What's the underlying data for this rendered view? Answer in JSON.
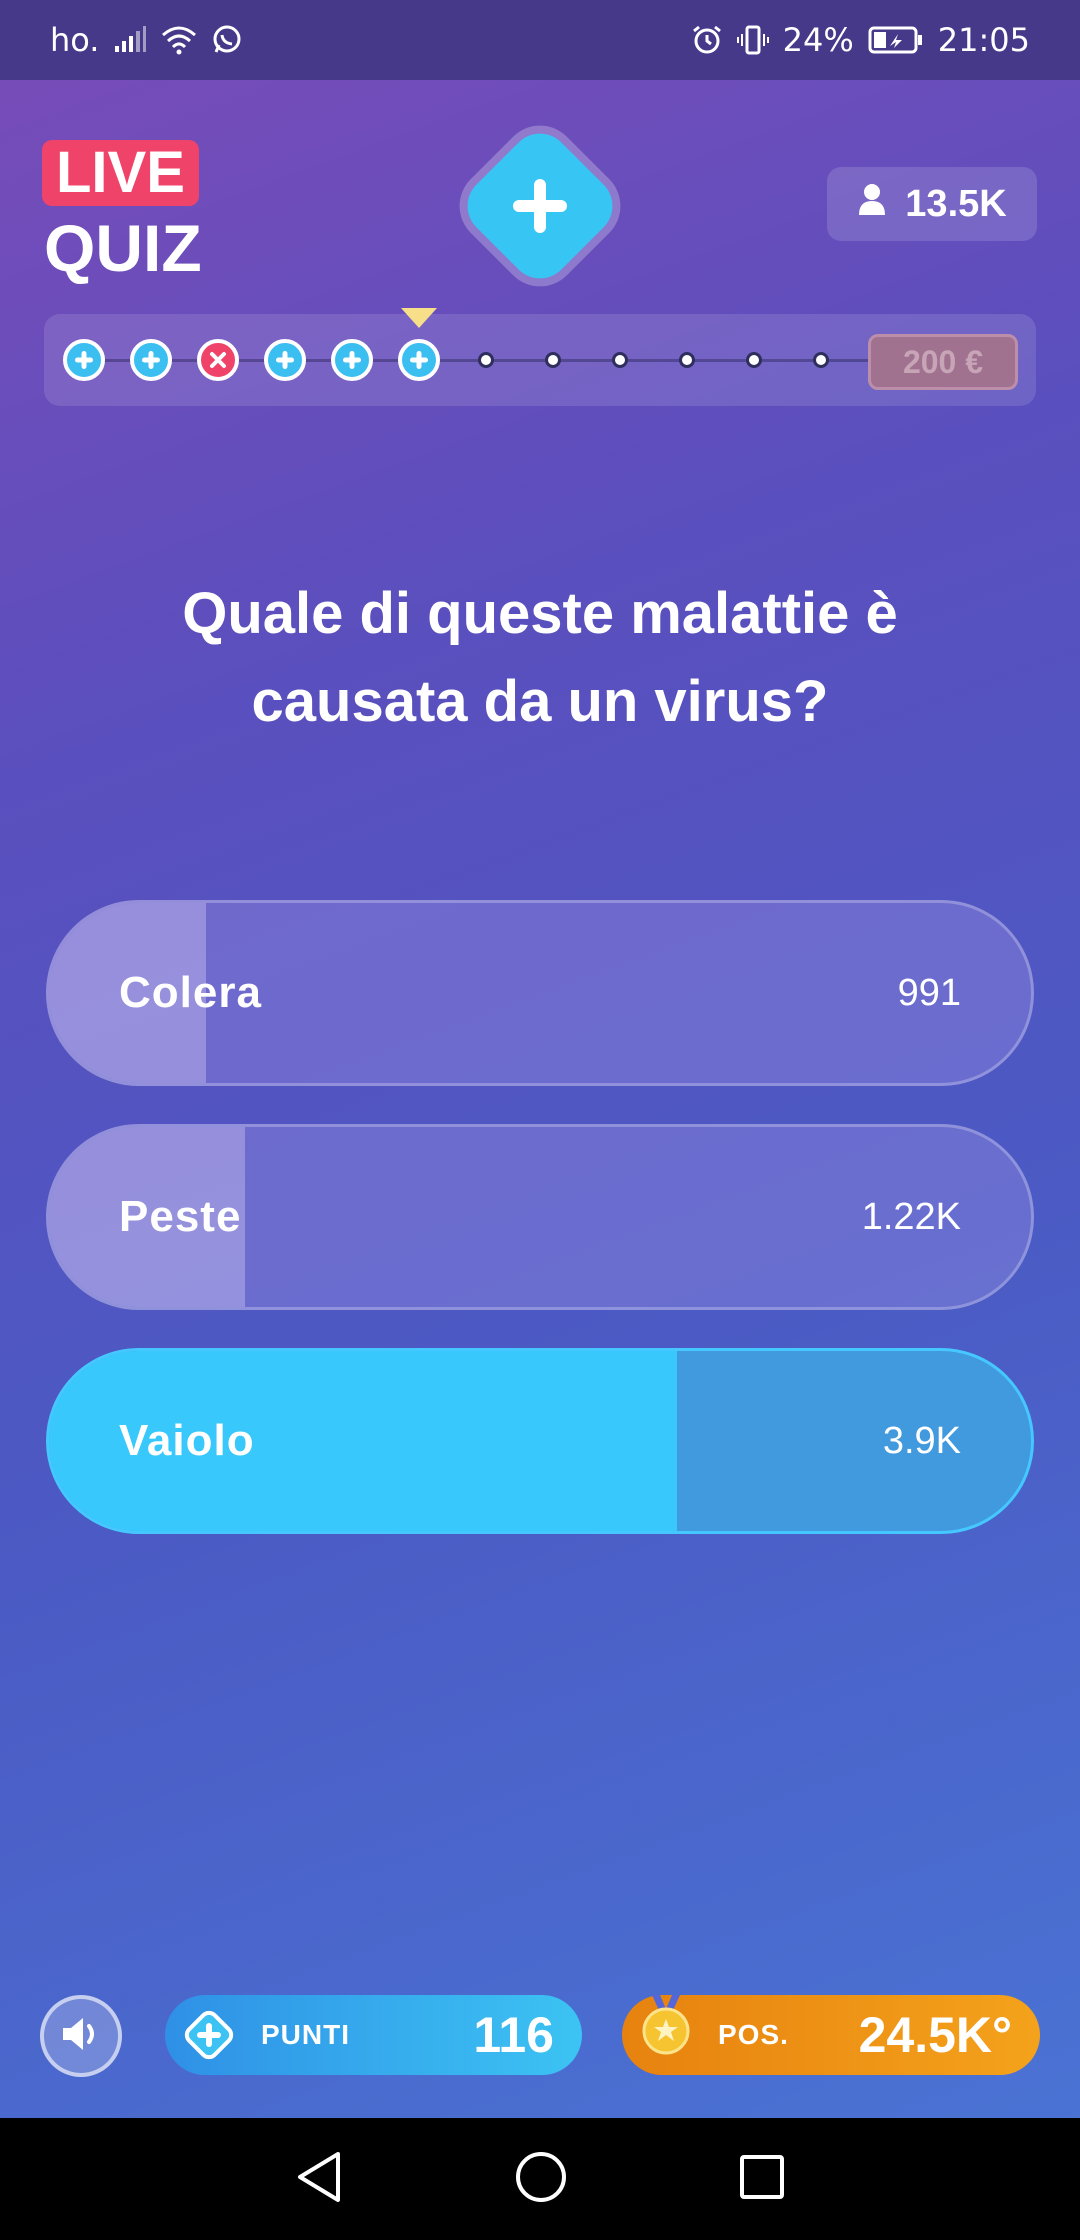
{
  "status_bar": {
    "carrier": "ho.",
    "battery": "24%",
    "time": "21:05",
    "icons": [
      "signal-icon",
      "wifi-icon",
      "whatsapp-icon",
      "alarm-icon",
      "vibrate-icon",
      "battery-icon"
    ]
  },
  "header": {
    "logo_live": "LIVE",
    "logo_quiz": "QUIZ",
    "viewers": "13.5K"
  },
  "progress": {
    "steps": [
      "correct",
      "correct",
      "wrong",
      "correct",
      "correct",
      "correct",
      "pending",
      "pending",
      "pending",
      "pending",
      "pending",
      "pending"
    ],
    "current_index": 5,
    "prize": "200 €"
  },
  "question": {
    "line1": "Quale di queste malattie è",
    "line2": "causata da un virus?"
  },
  "answers": [
    {
      "label": "Colera",
      "count": "991",
      "share": 0.16,
      "correct": false
    },
    {
      "label": "Peste",
      "count": "1.22K",
      "share": 0.2,
      "correct": false
    },
    {
      "label": "Vaiolo",
      "count": "3.9K",
      "share": 0.64,
      "correct": true
    }
  ],
  "footer": {
    "points_label": "PUNTI",
    "points_value": "116",
    "pos_label": "POS.",
    "pos_value": "24.5K°"
  },
  "colors": {
    "accent": "#38c8fb",
    "wrong": "#f0436a",
    "orange": "#f4a21b"
  }
}
